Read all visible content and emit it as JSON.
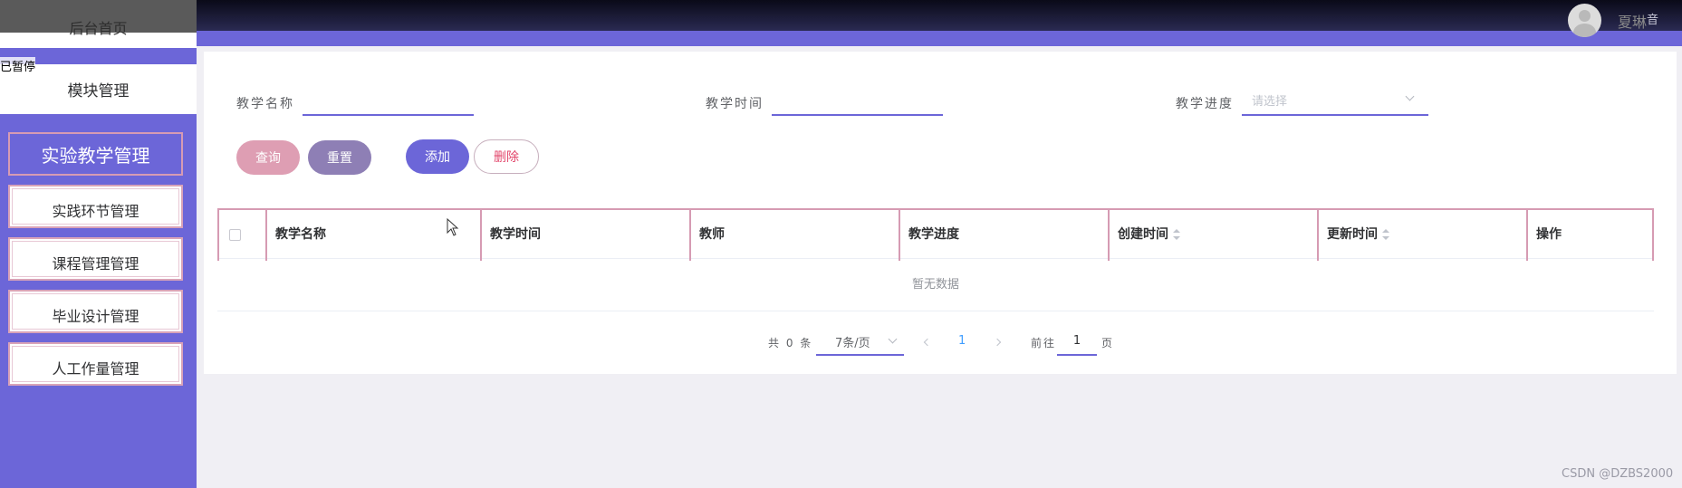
{
  "header": {
    "user_name": "夏琳",
    "user_role": "音"
  },
  "sidebar": {
    "home_label": "后台首页",
    "paused_label": "已暂停",
    "module_label": "模块管理",
    "active_item": "实验教学管理",
    "items": [
      {
        "label": "实践环节管理"
      },
      {
        "label": "课程管理管理"
      },
      {
        "label": "毕业设计管理"
      },
      {
        "label": "人工作量管理"
      }
    ]
  },
  "search": {
    "name_label": "教学名称",
    "name_value": "",
    "time_label": "教学时间",
    "time_value": "",
    "progress_label": "教学进度",
    "progress_placeholder": "请选择"
  },
  "actions": {
    "query": "查询",
    "reset": "重置",
    "add": "添加",
    "delete": "删除"
  },
  "table": {
    "columns": [
      "教学名称",
      "教学时间",
      "教师",
      "教学进度",
      "创建时间",
      "更新时间",
      "操作"
    ],
    "sortable": [
      "创建时间",
      "更新时间"
    ],
    "empty_text": "暂无数据"
  },
  "pagination": {
    "total_text": "共 0 条",
    "page_size": "7条/页",
    "current_page": "1",
    "goto_label": "前往",
    "goto_value": "1",
    "page_unit": "页"
  },
  "watermark": "CSDN @DZBS2000",
  "colors": {
    "accent": "#6c66d8",
    "pink": "#d69bb3",
    "query_button": "#de9eb3",
    "reset_button": "#8e7fb5",
    "delete_text": "#e2466b"
  }
}
